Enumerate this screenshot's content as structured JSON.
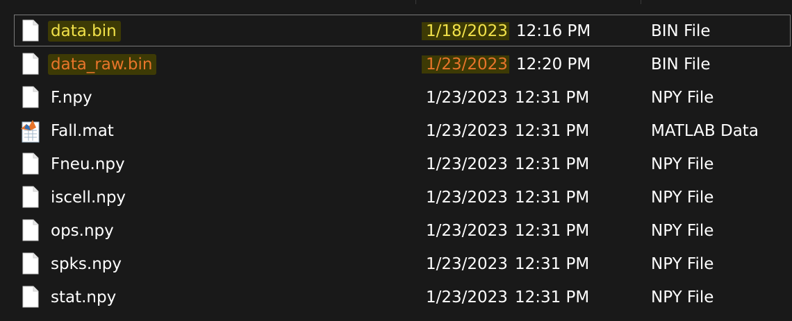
{
  "files": [
    {
      "name": "data.bin",
      "date": "1/18/2023",
      "time": "12:16 PM",
      "type": "BIN File",
      "icon": "file-icon",
      "selected": true,
      "highlight": "yellow"
    },
    {
      "name": "data_raw.bin",
      "date": "1/23/2023",
      "time": "12:20 PM",
      "type": "BIN File",
      "icon": "file-icon",
      "selected": false,
      "highlight": "orange"
    },
    {
      "name": "F.npy",
      "date": "1/23/2023",
      "time": "12:31 PM",
      "type": "NPY File",
      "icon": "file-icon",
      "selected": false,
      "highlight": ""
    },
    {
      "name": "Fall.mat",
      "date": "1/23/2023",
      "time": "12:31 PM",
      "type": "MATLAB Data",
      "icon": "matlab-file-icon",
      "selected": false,
      "highlight": ""
    },
    {
      "name": "Fneu.npy",
      "date": "1/23/2023",
      "time": "12:31 PM",
      "type": "NPY File",
      "icon": "file-icon",
      "selected": false,
      "highlight": ""
    },
    {
      "name": "iscell.npy",
      "date": "1/23/2023",
      "time": "12:31 PM",
      "type": "NPY File",
      "icon": "file-icon",
      "selected": false,
      "highlight": ""
    },
    {
      "name": "ops.npy",
      "date": "1/23/2023",
      "time": "12:31 PM",
      "type": "NPY File",
      "icon": "file-icon",
      "selected": false,
      "highlight": ""
    },
    {
      "name": "spks.npy",
      "date": "1/23/2023",
      "time": "12:31 PM",
      "type": "NPY File",
      "icon": "file-icon",
      "selected": false,
      "highlight": ""
    },
    {
      "name": "stat.npy",
      "date": "1/23/2023",
      "time": "12:31 PM",
      "type": "NPY File",
      "icon": "file-icon",
      "selected": false,
      "highlight": ""
    }
  ],
  "colors": {
    "background": "#191919",
    "text": "#ffffff",
    "highlight_yellow": "#f2e24a",
    "highlight_orange": "#e8752a",
    "highlight_bg": "#3d3a05",
    "selection_border": "#7a7a7a"
  }
}
